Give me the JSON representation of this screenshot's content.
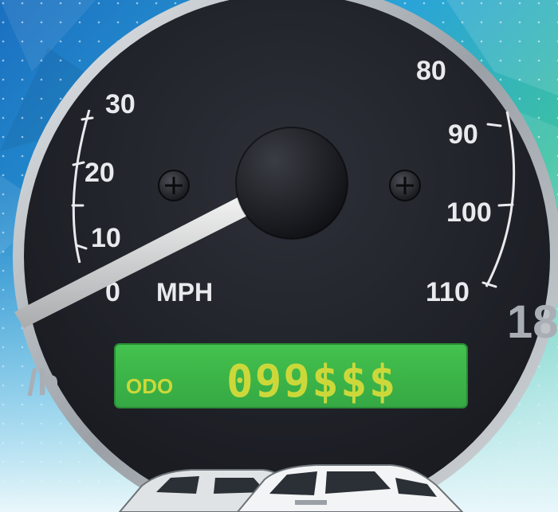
{
  "gauge": {
    "unit_label": "MPH",
    "partial_unit_label": "/h",
    "outer_partial_number": "18",
    "ticks": [
      "0",
      "10",
      "20",
      "30",
      "",
      "80",
      "90",
      "100",
      "110"
    ],
    "needle_value_mph": 0
  },
  "odometer": {
    "label": "ODO",
    "value": "099$$$"
  },
  "colors": {
    "dial": "#22252c",
    "bezel": "#c9ced3",
    "lcd": "#3db84a",
    "lcd_text": "#ccd83a",
    "background_top": "#1f8fd0",
    "background_green": "#3fbf9a"
  },
  "icons": [
    "center-hub-icon",
    "screw-left-icon",
    "screw-right-icon",
    "car-silhouettes-icon"
  ]
}
